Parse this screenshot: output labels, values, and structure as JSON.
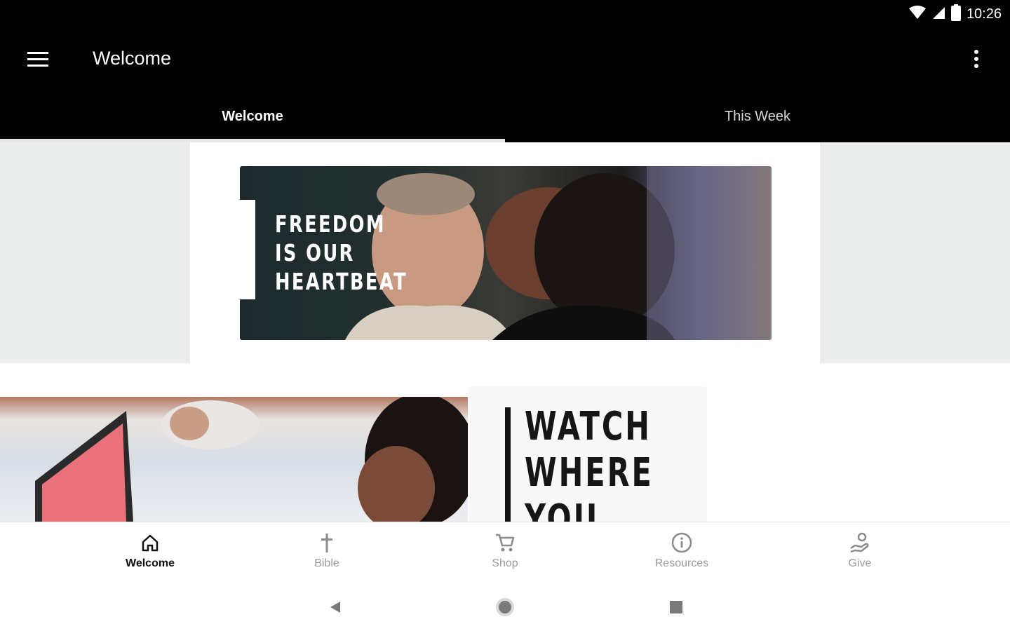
{
  "status_bar": {
    "time": "10:26"
  },
  "app_bar": {
    "title": "Welcome"
  },
  "tabs": [
    {
      "label": "Welcome",
      "active": true
    },
    {
      "label": "This Week",
      "active": false
    }
  ],
  "hero": {
    "lines": [
      "FREEDOM",
      "IS OUR",
      "HEARTBEAT"
    ]
  },
  "promo": {
    "lines": [
      "WATCH",
      "WHERE",
      "YOU ARE"
    ]
  },
  "bottom_nav": [
    {
      "label": "Welcome",
      "icon": "home-icon",
      "active": true
    },
    {
      "label": "Bible",
      "icon": "cross-icon",
      "active": false
    },
    {
      "label": "Shop",
      "icon": "cart-icon",
      "active": false
    },
    {
      "label": "Resources",
      "icon": "info-icon",
      "active": false
    },
    {
      "label": "Give",
      "icon": "giving-hand-icon",
      "active": false
    }
  ],
  "colors": {
    "bar": "#000000",
    "active_text": "#111111",
    "inactive_text": "#9a9a9a",
    "side_panel": "#eceded"
  }
}
